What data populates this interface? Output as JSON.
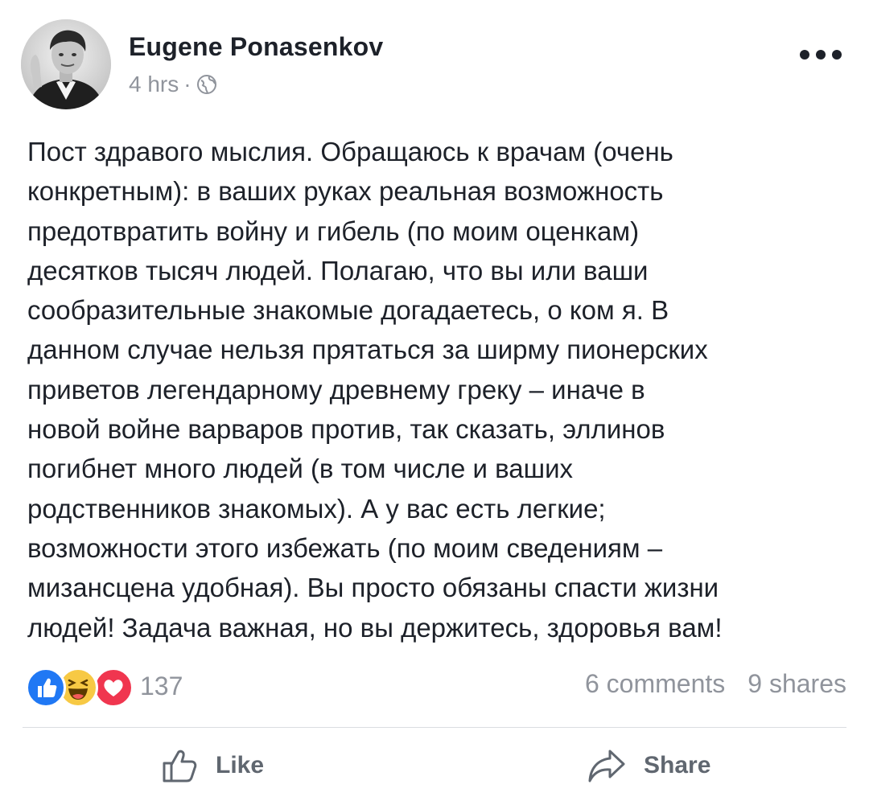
{
  "post": {
    "author": "Eugene Ponasenkov",
    "time": "4 hrs",
    "separator": "·",
    "privacy_icon": "globe-icon",
    "more_icon": "ellipsis-icon",
    "text_lines": [
      "Пост здравого мыслия. Обращаюсь к врачам (очень",
      "конкретным): в ваших руках реальная возможность",
      "предотвратить войну и гибель (по моим оценкам)",
      "десятков тысяч людей. Полагаю, что вы или ваши",
      "сообразительные знакомые догадаетесь, о ком я. В",
      "данном случае нельзя прятаться за ширму пионерских",
      "приветов легендарному древнему греку – иначе в",
      "новой войне варваров против, так сказать, эллинов",
      "погибнет много людей (в том числе и ваших",
      "родственников знакомых). А у вас есть легкие;",
      "возможности этого избежать (по моим сведениям –",
      "мизансцена удобная). Вы просто обязаны спасти жизни",
      "людей! Задача важная, но вы держитесь, здоровья вам!"
    ]
  },
  "reactions": {
    "icons": [
      "like-reaction-icon",
      "haha-reaction-icon",
      "love-reaction-icon"
    ],
    "colors": {
      "like": "#2078f4",
      "haha": "#f7c944",
      "love": "#f0364f"
    },
    "count": "137"
  },
  "stats": {
    "comments": "6 comments",
    "shares": "9 shares"
  },
  "actions": {
    "like_label": "Like",
    "share_label": "Share"
  }
}
